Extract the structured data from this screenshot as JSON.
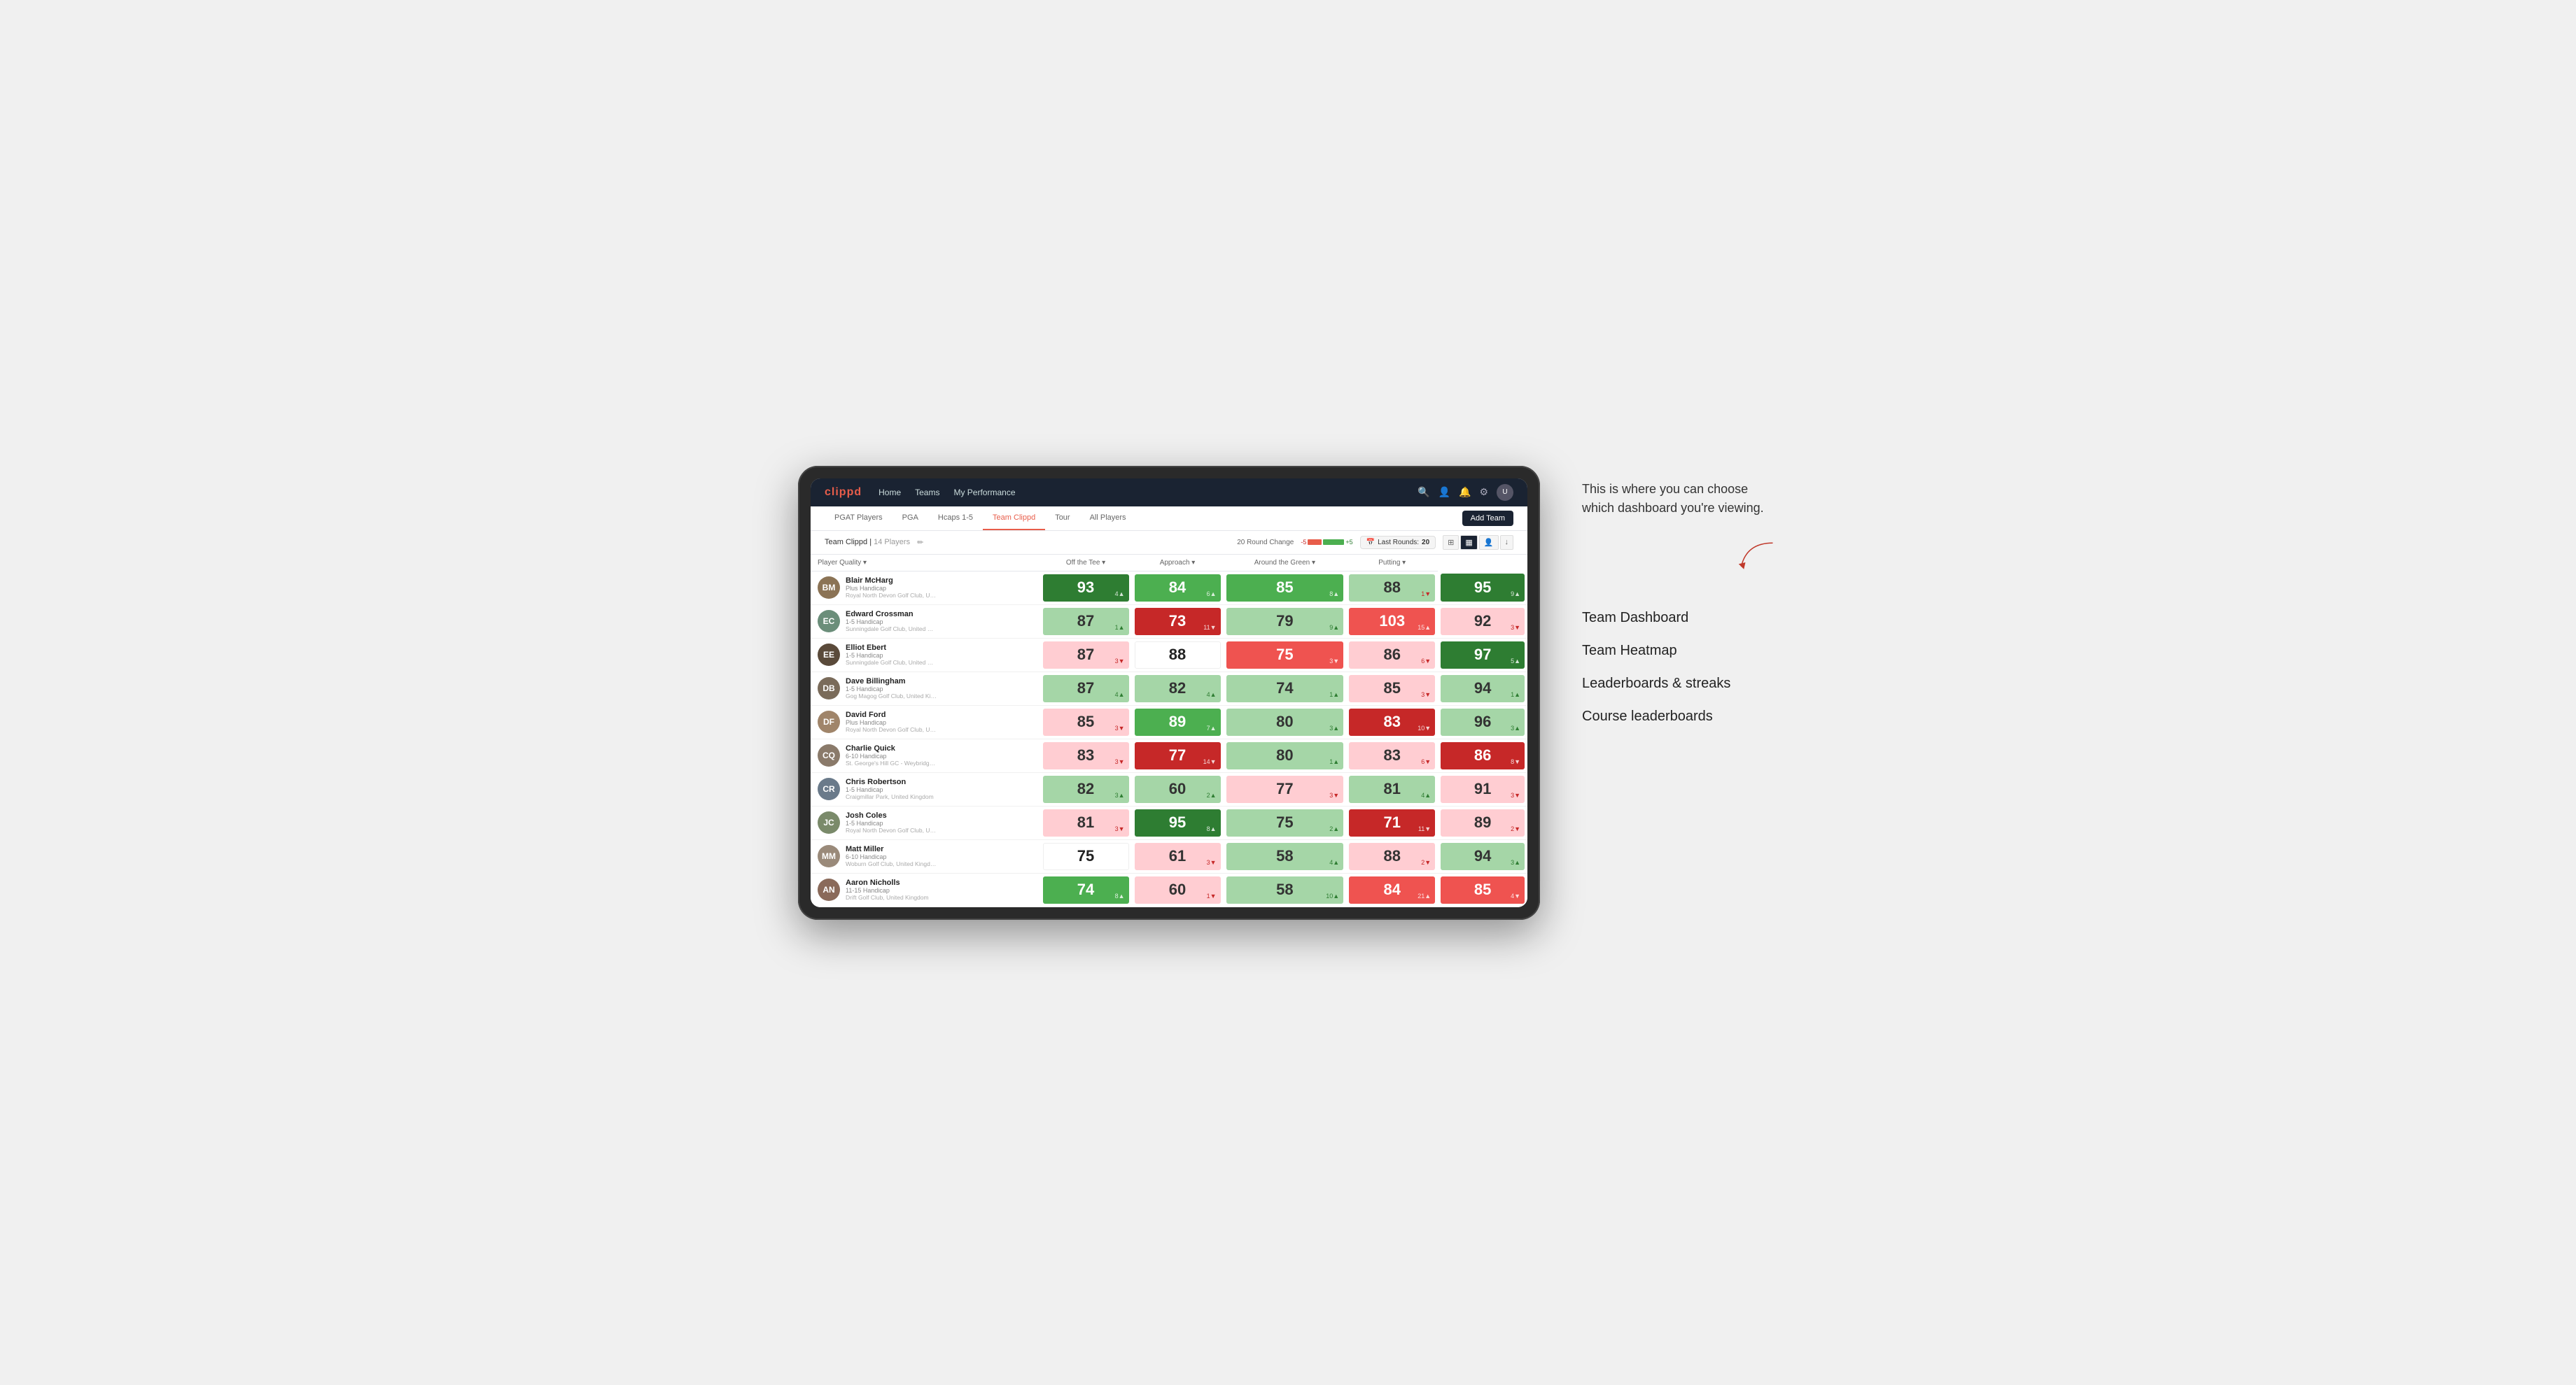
{
  "annotation": {
    "text": "This is where you can choose which dashboard you're viewing.",
    "menu_items": [
      "Team Dashboard",
      "Team Heatmap",
      "Leaderboards & streaks",
      "Course leaderboards"
    ]
  },
  "nav": {
    "logo": "clippd",
    "links": [
      "Home",
      "Teams",
      "My Performance"
    ],
    "icons": [
      "search",
      "person",
      "bell",
      "settings",
      "avatar"
    ]
  },
  "sub_nav": {
    "tabs": [
      "PGAT Players",
      "PGA",
      "Hcaps 1-5",
      "Team Clippd",
      "Tour",
      "All Players"
    ],
    "active_tab": "Team Clippd",
    "add_button": "Add Team"
  },
  "team_bar": {
    "team_name": "Team Clippd",
    "player_count": "14 Players",
    "round_change_label": "20 Round Change",
    "round_neg": "-5",
    "round_pos": "+5",
    "last_rounds_label": "Last Rounds:",
    "last_rounds_value": "20"
  },
  "table": {
    "columns": [
      {
        "label": "Player Quality ▾",
        "key": "quality"
      },
      {
        "label": "Off the Tee ▾",
        "key": "tee"
      },
      {
        "label": "Approach ▾",
        "key": "approach"
      },
      {
        "label": "Around the Green ▾",
        "key": "green"
      },
      {
        "label": "Putting ▾",
        "key": "putting"
      }
    ],
    "players": [
      {
        "name": "Blair McHarg",
        "handicap": "Plus Handicap",
        "club": "Royal North Devon Golf Club, United Kingdom",
        "avatar_color": "#8B7355",
        "initials": "BM",
        "quality": {
          "value": 93,
          "delta": "+4",
          "dir": "up",
          "color": "green-dark"
        },
        "tee": {
          "value": 84,
          "delta": "+6",
          "dir": "up",
          "color": "green-mid"
        },
        "approach": {
          "value": 85,
          "delta": "+8",
          "dir": "up",
          "color": "green-mid"
        },
        "green": {
          "value": 88,
          "delta": "-1",
          "dir": "down",
          "color": "green-light"
        },
        "putting": {
          "value": 95,
          "delta": "+9",
          "dir": "up",
          "color": "green-dark"
        }
      },
      {
        "name": "Edward Crossman",
        "handicap": "1-5 Handicap",
        "club": "Sunningdale Golf Club, United Kingdom",
        "avatar_color": "#6B8E7A",
        "initials": "EC",
        "quality": {
          "value": 87,
          "delta": "+1",
          "dir": "up",
          "color": "green-light"
        },
        "tee": {
          "value": 73,
          "delta": "-11",
          "dir": "down",
          "color": "red-dark"
        },
        "approach": {
          "value": 79,
          "delta": "+9",
          "dir": "up",
          "color": "green-light"
        },
        "green": {
          "value": 103,
          "delta": "+15",
          "dir": "up",
          "color": "red-mid"
        },
        "putting": {
          "value": 92,
          "delta": "-3",
          "dir": "down",
          "color": "red-light"
        }
      },
      {
        "name": "Elliot Ebert",
        "handicap": "1-5 Handicap",
        "club": "Sunningdale Golf Club, United Kingdom",
        "avatar_color": "#5A4A3A",
        "initials": "EE",
        "quality": {
          "value": 87,
          "delta": "-3",
          "dir": "down",
          "color": "red-light"
        },
        "tee": {
          "value": 88,
          "delta": "",
          "dir": "",
          "color": "white-bg"
        },
        "approach": {
          "value": 75,
          "delta": "-3",
          "dir": "down",
          "color": "red-mid"
        },
        "green": {
          "value": 86,
          "delta": "-6",
          "dir": "down",
          "color": "red-light"
        },
        "putting": {
          "value": 97,
          "delta": "+5",
          "dir": "up",
          "color": "green-dark"
        }
      },
      {
        "name": "Dave Billingham",
        "handicap": "1-5 Handicap",
        "club": "Gog Magog Golf Club, United Kingdom",
        "avatar_color": "#7A6B5A",
        "initials": "DB",
        "quality": {
          "value": 87,
          "delta": "+4",
          "dir": "up",
          "color": "green-light"
        },
        "tee": {
          "value": 82,
          "delta": "+4",
          "dir": "up",
          "color": "green-light"
        },
        "approach": {
          "value": 74,
          "delta": "+1",
          "dir": "up",
          "color": "green-light"
        },
        "green": {
          "value": 85,
          "delta": "-3",
          "dir": "down",
          "color": "red-light"
        },
        "putting": {
          "value": 94,
          "delta": "+1",
          "dir": "up",
          "color": "green-light"
        }
      },
      {
        "name": "David Ford",
        "handicap": "Plus Handicap",
        "club": "Royal North Devon Golf Club, United Kingdom",
        "avatar_color": "#A0856A",
        "initials": "DF",
        "quality": {
          "value": 85,
          "delta": "-3",
          "dir": "down",
          "color": "red-light"
        },
        "tee": {
          "value": 89,
          "delta": "+7",
          "dir": "up",
          "color": "green-mid"
        },
        "approach": {
          "value": 80,
          "delta": "+3",
          "dir": "up",
          "color": "green-light"
        },
        "green": {
          "value": 83,
          "delta": "-10",
          "dir": "down",
          "color": "red-dark"
        },
        "putting": {
          "value": 96,
          "delta": "+3",
          "dir": "up",
          "color": "green-light"
        }
      },
      {
        "name": "Charlie Quick",
        "handicap": "6-10 Handicap",
        "club": "St. George's Hill GC - Weybridge - Surrey, Uni...",
        "avatar_color": "#8A7A6A",
        "initials": "CQ",
        "quality": {
          "value": 83,
          "delta": "-3",
          "dir": "down",
          "color": "red-light"
        },
        "tee": {
          "value": 77,
          "delta": "-14",
          "dir": "down",
          "color": "red-dark"
        },
        "approach": {
          "value": 80,
          "delta": "+1",
          "dir": "up",
          "color": "green-light"
        },
        "green": {
          "value": 83,
          "delta": "-6",
          "dir": "down",
          "color": "red-light"
        },
        "putting": {
          "value": 86,
          "delta": "-8",
          "dir": "down",
          "color": "red-dark"
        }
      },
      {
        "name": "Chris Robertson",
        "handicap": "1-5 Handicap",
        "club": "Craigmillar Park, United Kingdom",
        "avatar_color": "#6A7A8A",
        "initials": "CR",
        "quality": {
          "value": 82,
          "delta": "+3",
          "dir": "up",
          "color": "green-light"
        },
        "tee": {
          "value": 60,
          "delta": "+2",
          "dir": "up",
          "color": "green-light"
        },
        "approach": {
          "value": 77,
          "delta": "-3",
          "dir": "down",
          "color": "red-light"
        },
        "green": {
          "value": 81,
          "delta": "+4",
          "dir": "up",
          "color": "green-light"
        },
        "putting": {
          "value": 91,
          "delta": "-3",
          "dir": "down",
          "color": "red-light"
        }
      },
      {
        "name": "Josh Coles",
        "handicap": "1-5 Handicap",
        "club": "Royal North Devon Golf Club, United Kingdom",
        "avatar_color": "#7A8A6A",
        "initials": "JC",
        "quality": {
          "value": 81,
          "delta": "-3",
          "dir": "down",
          "color": "red-light"
        },
        "tee": {
          "value": 95,
          "delta": "+8",
          "dir": "up",
          "color": "green-dark"
        },
        "approach": {
          "value": 75,
          "delta": "+2",
          "dir": "up",
          "color": "green-light"
        },
        "green": {
          "value": 71,
          "delta": "-11",
          "dir": "down",
          "color": "red-dark"
        },
        "putting": {
          "value": 89,
          "delta": "-2",
          "dir": "down",
          "color": "red-light"
        }
      },
      {
        "name": "Matt Miller",
        "handicap": "6-10 Handicap",
        "club": "Woburn Golf Club, United Kingdom",
        "avatar_color": "#9A8A7A",
        "initials": "MM",
        "quality": {
          "value": 75,
          "delta": "",
          "dir": "",
          "color": "white-bg"
        },
        "tee": {
          "value": 61,
          "delta": "-3",
          "dir": "down",
          "color": "red-light"
        },
        "approach": {
          "value": 58,
          "delta": "+4",
          "dir": "up",
          "color": "green-light"
        },
        "green": {
          "value": 88,
          "delta": "-2",
          "dir": "down",
          "color": "red-light"
        },
        "putting": {
          "value": 94,
          "delta": "+3",
          "dir": "up",
          "color": "green-light"
        }
      },
      {
        "name": "Aaron Nicholls",
        "handicap": "11-15 Handicap",
        "club": "Drift Golf Club, United Kingdom",
        "avatar_color": "#8A6A5A",
        "initials": "AN",
        "quality": {
          "value": 74,
          "delta": "+8",
          "dir": "up",
          "color": "green-mid"
        },
        "tee": {
          "value": 60,
          "delta": "-1",
          "dir": "down",
          "color": "red-light"
        },
        "approach": {
          "value": 58,
          "delta": "+10",
          "dir": "up",
          "color": "green-light"
        },
        "green": {
          "value": 84,
          "delta": "+21",
          "dir": "up",
          "color": "red-mid"
        },
        "putting": {
          "value": 85,
          "delta": "-4",
          "dir": "down",
          "color": "red-mid"
        }
      }
    ]
  }
}
